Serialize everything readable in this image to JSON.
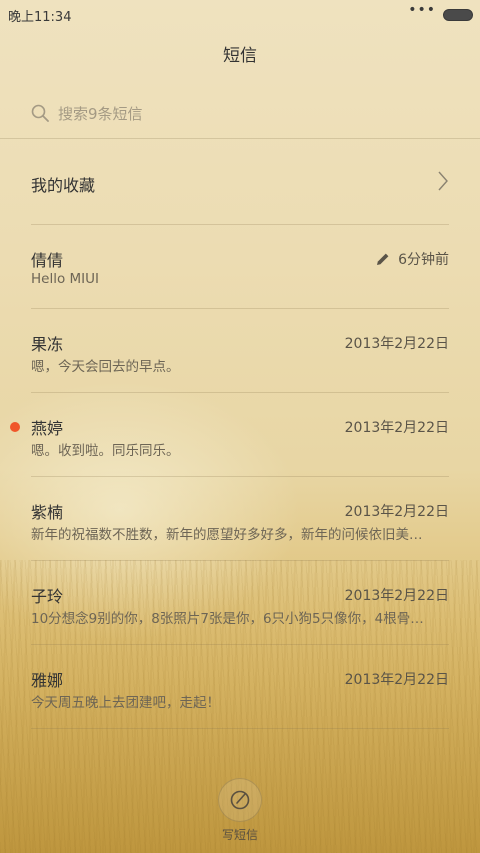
{
  "status_bar": {
    "time": "晚上11:34",
    "dots": "•••"
  },
  "header": {
    "title": "短信"
  },
  "search": {
    "placeholder": "搜索9条短信"
  },
  "favorites": {
    "label": "我的收藏"
  },
  "messages": [
    {
      "name": "倩倩",
      "date": "6分钟前",
      "preview": "Hello MIUI",
      "draft": true,
      "unread": false
    },
    {
      "name": "果冻",
      "date": "2013年2月22日",
      "preview": "嗯，今天会回去的早点。",
      "draft": false,
      "unread": false
    },
    {
      "name": "燕婷",
      "date": "2013年2月22日",
      "preview": "嗯。收到啦。同乐同乐。",
      "draft": false,
      "unread": true
    },
    {
      "name": "紫楠",
      "date": "2013年2月22日",
      "preview": "新年的祝福数不胜数，新年的愿望好多好多，新年的问候依旧美…",
      "draft": false,
      "unread": false
    },
    {
      "name": "子玲",
      "date": "2013年2月22日",
      "preview": "10分想念9别的你，8张照片7张是你，6只小狗5只像你，4根骨…",
      "draft": false,
      "unread": false
    },
    {
      "name": "雅娜",
      "date": "2013年2月22日",
      "preview": "今天周五晚上去团建吧，走起！",
      "draft": false,
      "unread": false
    }
  ],
  "compose": {
    "label": "写短信"
  },
  "colors": {
    "unread_dot": "#f0562a",
    "background": "#ecdcb2"
  }
}
